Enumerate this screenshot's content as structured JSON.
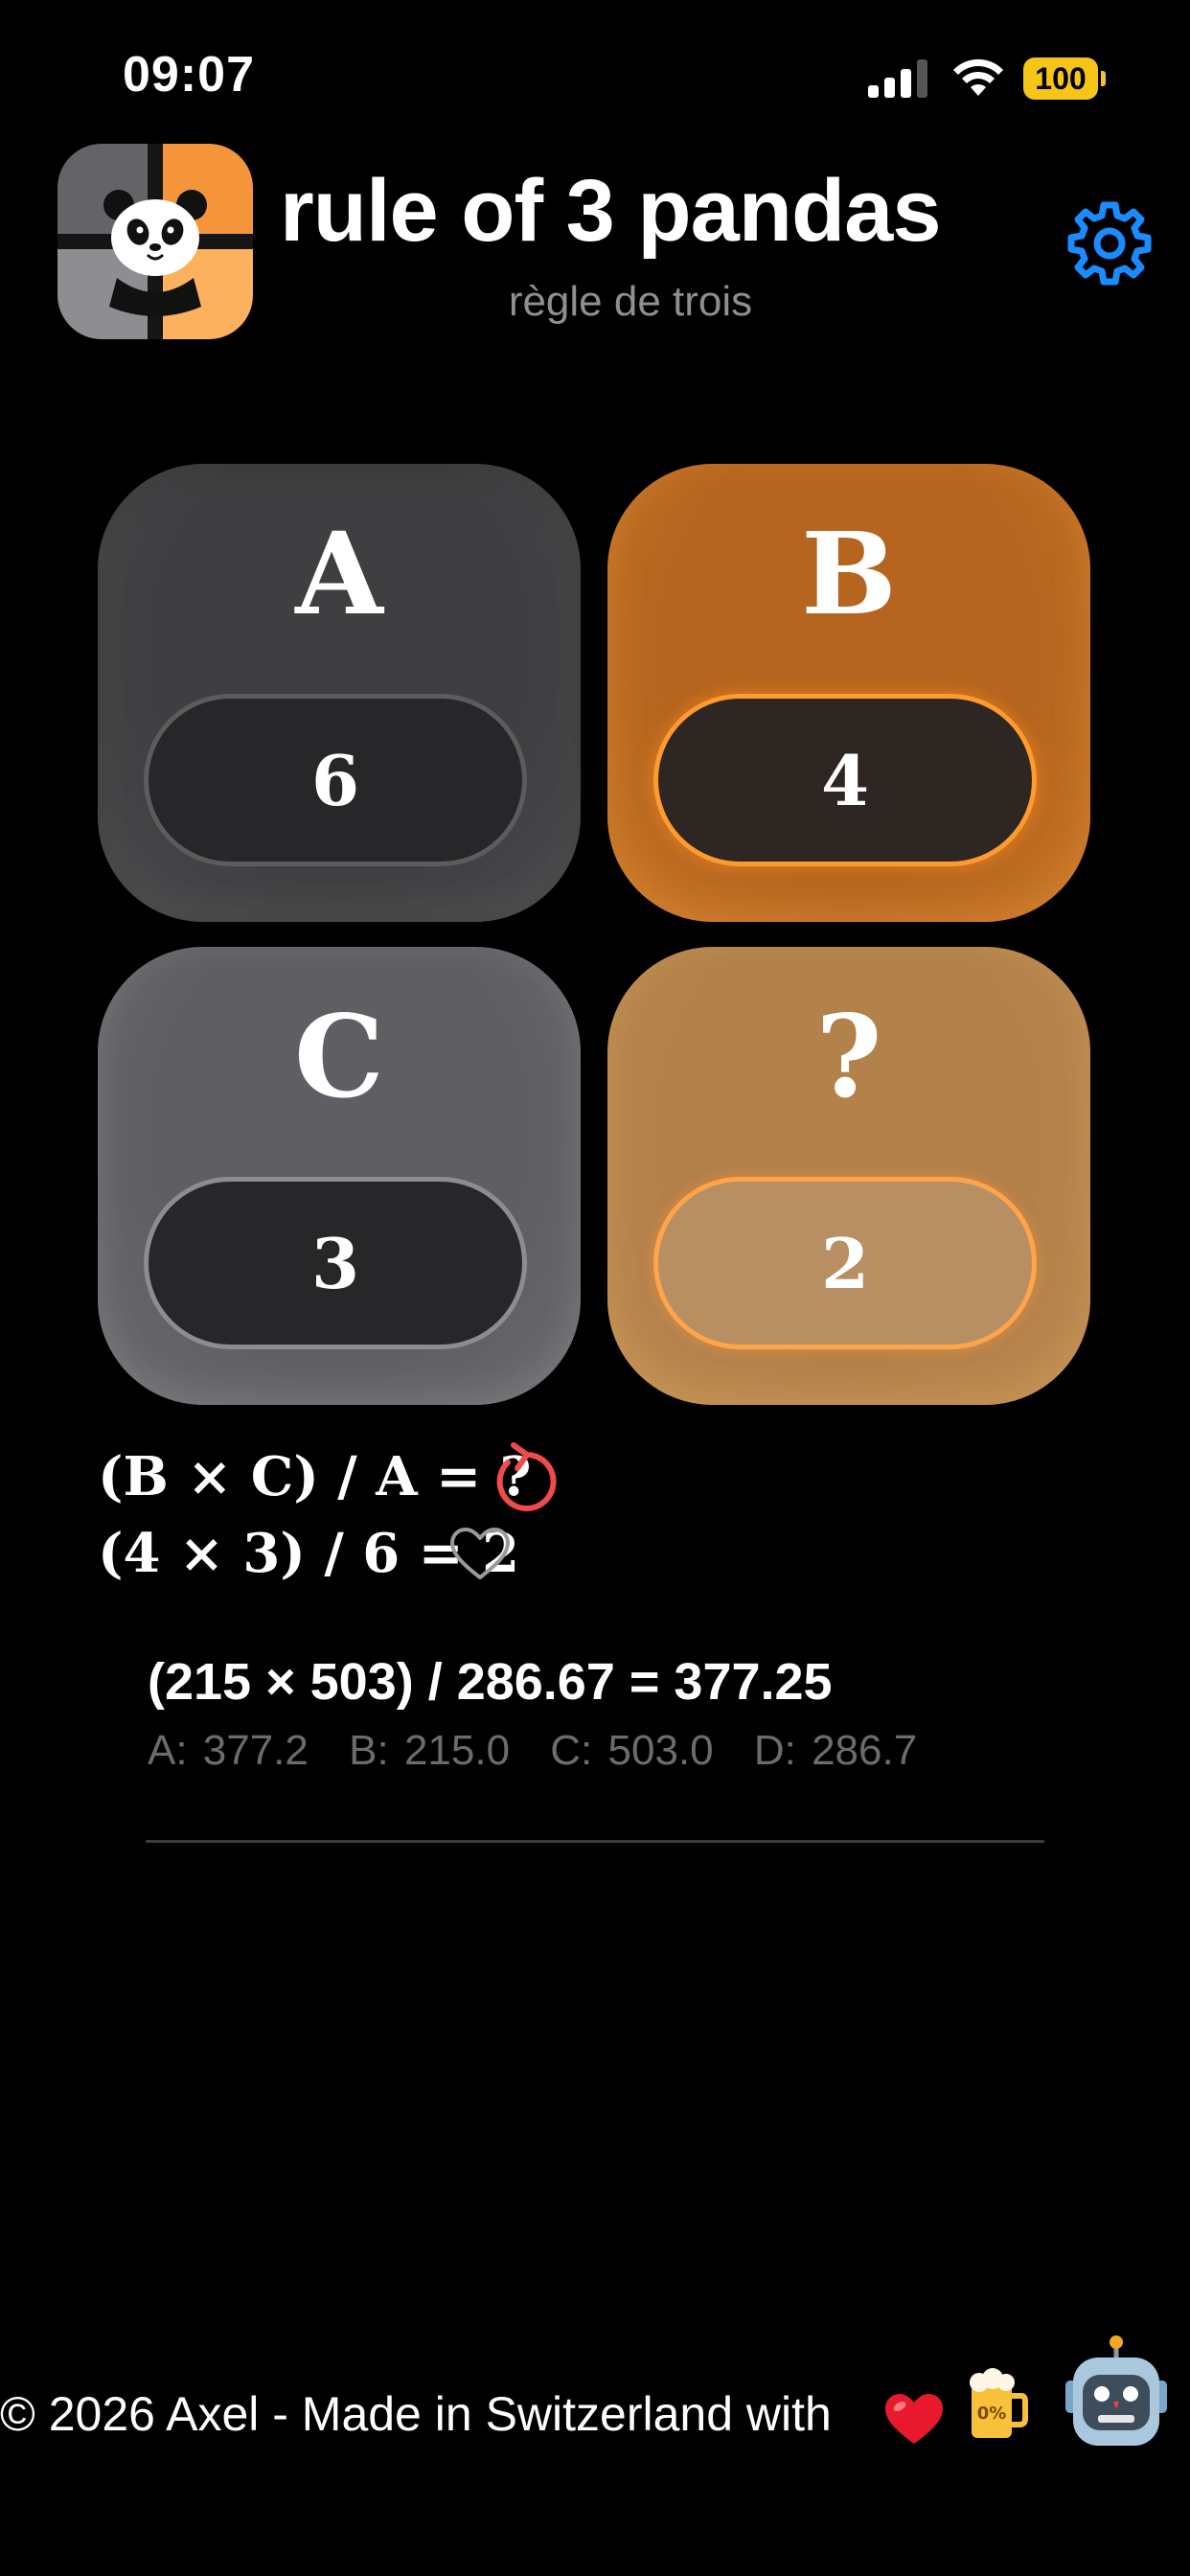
{
  "status_bar": {
    "time": "09:07",
    "battery_level": "100"
  },
  "header": {
    "title": "rule of 3 pandas",
    "subtitle": "règle de trois",
    "settings_icon": "gear-icon",
    "accent_color": "#1a8cff"
  },
  "tiles": [
    {
      "letter": "A",
      "value": "6"
    },
    {
      "letter": "B",
      "value": "4"
    },
    {
      "letter": "C",
      "value": "3"
    },
    {
      "letter": "?",
      "value": "2"
    }
  ],
  "formula": {
    "symbolic": "(B × C) / A = ?",
    "numeric": "(4 × 3) / 6 = 2",
    "reset_icon": "reset-icon",
    "favorite_icon": "heart-outline-icon"
  },
  "history": {
    "result": "(215 × 503) / 286.67 = 377.25",
    "values": [
      "A: 377.2",
      "B: 215.0",
      "C: 503.0",
      "D: 286.7"
    ]
  },
  "footer": {
    "text": "© 2026 Axel - Made in Switzerland with",
    "beer_label": "0%"
  }
}
